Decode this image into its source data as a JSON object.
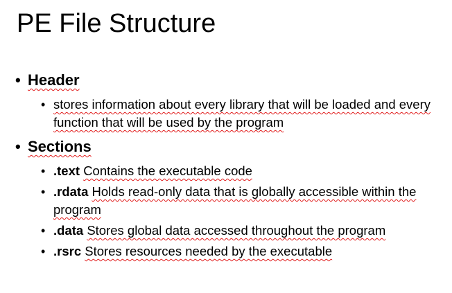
{
  "slide": {
    "title": "PE File Structure",
    "bullet_glyph": "•",
    "sections": [
      {
        "heading": "Header",
        "items": [
          {
            "tag": "",
            "text": "stores information about every library that will be loaded and every function that will be used by the program"
          }
        ]
      },
      {
        "heading": "Sections",
        "items": [
          {
            "tag": ".text",
            "text": "Contains the executable code"
          },
          {
            "tag": ".rdata",
            "text": "Holds read-only data that is globally accessible within the program"
          },
          {
            "tag": ".data",
            "text": "Stores global data accessed throughout the program"
          },
          {
            "tag": ".rsrc",
            "text": "Stores resources needed by the executable"
          }
        ]
      }
    ]
  }
}
